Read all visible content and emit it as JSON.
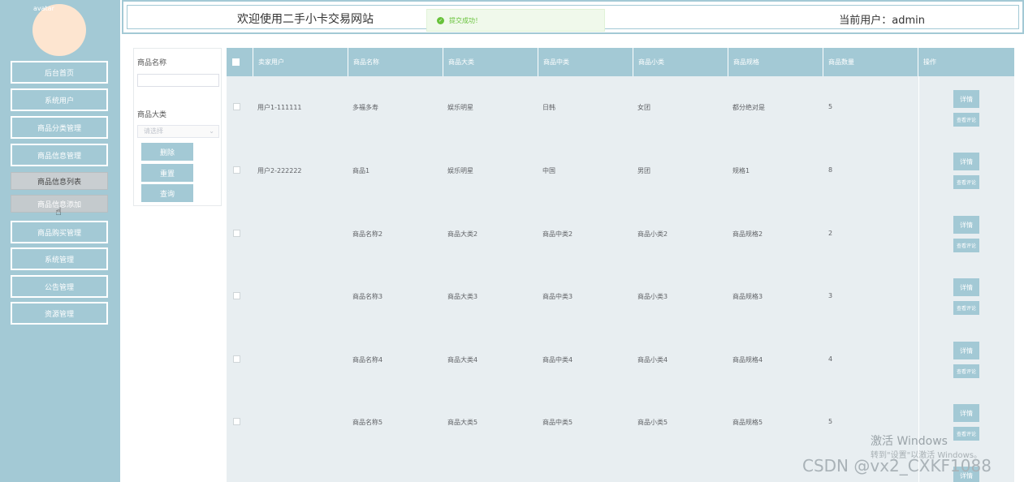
{
  "sidebar": {
    "avatar_alt": "avatar",
    "items": [
      {
        "label": "后台首页"
      },
      {
        "label": "系统用户"
      },
      {
        "label": "商品分类管理"
      },
      {
        "label": "商品信息管理"
      }
    ],
    "sub_items": [
      {
        "label": "商品信息列表"
      },
      {
        "label": "商品信息添加"
      }
    ],
    "items_after": [
      {
        "label": "商品购买管理"
      },
      {
        "label": "系统管理"
      },
      {
        "label": "公告管理"
      },
      {
        "label": "资源管理"
      }
    ]
  },
  "header": {
    "title": "欢迎使用二手小卡交易网站",
    "current_user": "当前用户：admin"
  },
  "toast": {
    "message": "提交成功！"
  },
  "search": {
    "name_label": "商品名称",
    "name_value": "",
    "category_label": "商品大类",
    "category_placeholder": "请选择",
    "delete_label": "删除",
    "reset_label": "重置",
    "query_label": "查询"
  },
  "table": {
    "columns": [
      "卖家用户",
      "商品名称",
      "商品大类",
      "商品中类",
      "商品小类",
      "商品规格",
      "商品数量",
      "操作"
    ],
    "detail_label": "详情",
    "comment_label": "查看评论",
    "rows": [
      {
        "seller": "用户1-111111",
        "name": "多福多寿",
        "major": "娱乐明星",
        "middle": "日韩",
        "minor": "女团",
        "spec": "都分绝对是",
        "qty": "5"
      },
      {
        "seller": "用户2-222222",
        "name": "商品1",
        "major": "娱乐明星",
        "middle": "中国",
        "minor": "男团",
        "spec": "规格1",
        "qty": "8"
      },
      {
        "seller": "",
        "name": "商品名称2",
        "major": "商品大类2",
        "middle": "商品中类2",
        "minor": "商品小类2",
        "spec": "商品规格2",
        "qty": "2"
      },
      {
        "seller": "",
        "name": "商品名称3",
        "major": "商品大类3",
        "middle": "商品中类3",
        "minor": "商品小类3",
        "spec": "商品规格3",
        "qty": "3"
      },
      {
        "seller": "",
        "name": "商品名称4",
        "major": "商品大类4",
        "middle": "商品中类4",
        "minor": "商品小类4",
        "spec": "商品规格4",
        "qty": "4"
      },
      {
        "seller": "",
        "name": "商品名称5",
        "major": "商品大类5",
        "middle": "商品中类5",
        "minor": "商品小类5",
        "spec": "商品规格5",
        "qty": "5"
      }
    ],
    "partial_row_detail_label": "详情"
  },
  "watermarks": {
    "windows_line1": "激活 Windows",
    "windows_line2": "转到\"设置\"以激活 Windows。",
    "csdn": "CSDN @vx2_CXKF1088"
  },
  "colors": {
    "accent": "#a3c9d5",
    "table_bg": "#e8eef1",
    "success": "#67c23a",
    "avatar": "#fde5d0"
  }
}
